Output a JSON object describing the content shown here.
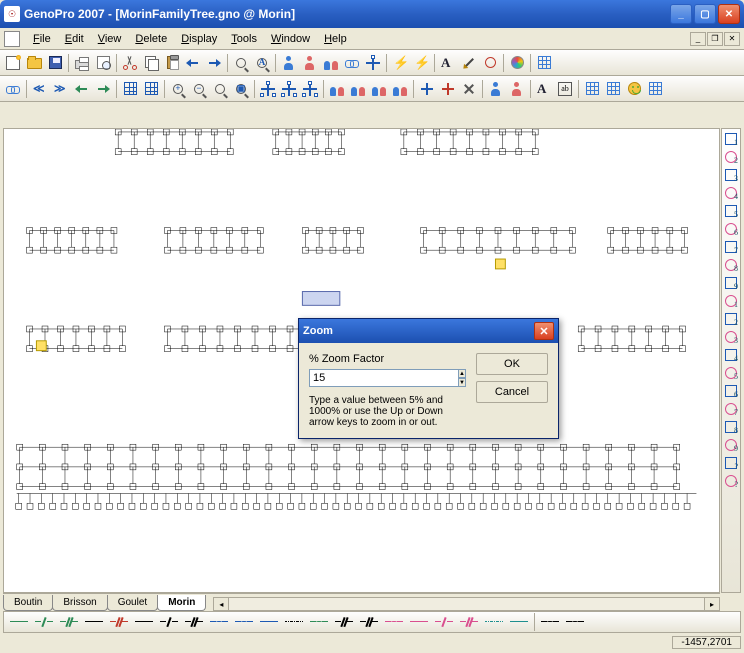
{
  "window": {
    "title": "GenoPro 2007 - [MorinFamilyTree.gno @ Morin]"
  },
  "menu": {
    "items": [
      "File",
      "Edit",
      "View",
      "Delete",
      "Display",
      "Tools",
      "Window",
      "Help"
    ]
  },
  "tabs": {
    "items": [
      "Boutin",
      "Brisson",
      "Goulet",
      "Morin"
    ],
    "active": 3
  },
  "statusbar": {
    "coords": "-1457,2701"
  },
  "dialog": {
    "title": "Zoom",
    "label": "% Zoom Factor",
    "value": "15",
    "help": "Type a value between 5% and 1000% or use the Up or Down arrow keys to zoom in or out.",
    "ok": "OK",
    "cancel": "Cancel"
  },
  "icons": {
    "toolbar1": [
      "new",
      "open",
      "save",
      "sep",
      "print",
      "preview",
      "sep",
      "cut",
      "copy",
      "paste",
      "undo",
      "redo",
      "sep",
      "find",
      "replace",
      "sep",
      "new-person",
      "new-person2",
      "new-family",
      "link-persons",
      "link-parents",
      "sep",
      "bolt",
      "bolt2",
      "sep",
      "text",
      "pen",
      "ring",
      "sep",
      "color",
      "sep",
      "grid"
    ],
    "toolbar2": [
      "hyperlink",
      "sep",
      "chev-left",
      "chev-right",
      "arrow-left",
      "arrow-right",
      "sep",
      "table",
      "table-cols",
      "sep",
      "zoom-in",
      "zoom-out",
      "zoom",
      "fit",
      "sep",
      "tree-up",
      "tree-down",
      "tree-both",
      "sep",
      "people",
      "people2",
      "people3",
      "people4",
      "sep",
      "cross-blue",
      "cross-red",
      "cross-x",
      "sep",
      "person-blue",
      "person-pink",
      "sep",
      "font",
      "text-box",
      "sep",
      "grid-large",
      "grid-small",
      "smile",
      "grid-dots"
    ],
    "right": [
      "1",
      "2",
      "3",
      "4",
      "5",
      "6",
      "7",
      "8",
      "9",
      "1",
      "2",
      "3",
      "4",
      "5",
      "6",
      "7",
      "8",
      "9",
      "?",
      "?"
    ],
    "bottom": [
      "green-solid",
      "green-slash",
      "green-dslash",
      "black-solid",
      "red-dslash",
      "dash",
      "dash-slash",
      "dash-dslash",
      "blue-wave",
      "blue-wave",
      "blue-dash",
      "dot",
      "green-wave",
      "dslash-tall",
      "x-line",
      "pink-wave",
      "pink-dash",
      "pink-slash",
      "pink-dslash",
      "teal-dot",
      "teal-dash",
      "sep",
      "wave-red",
      "zig"
    ]
  }
}
